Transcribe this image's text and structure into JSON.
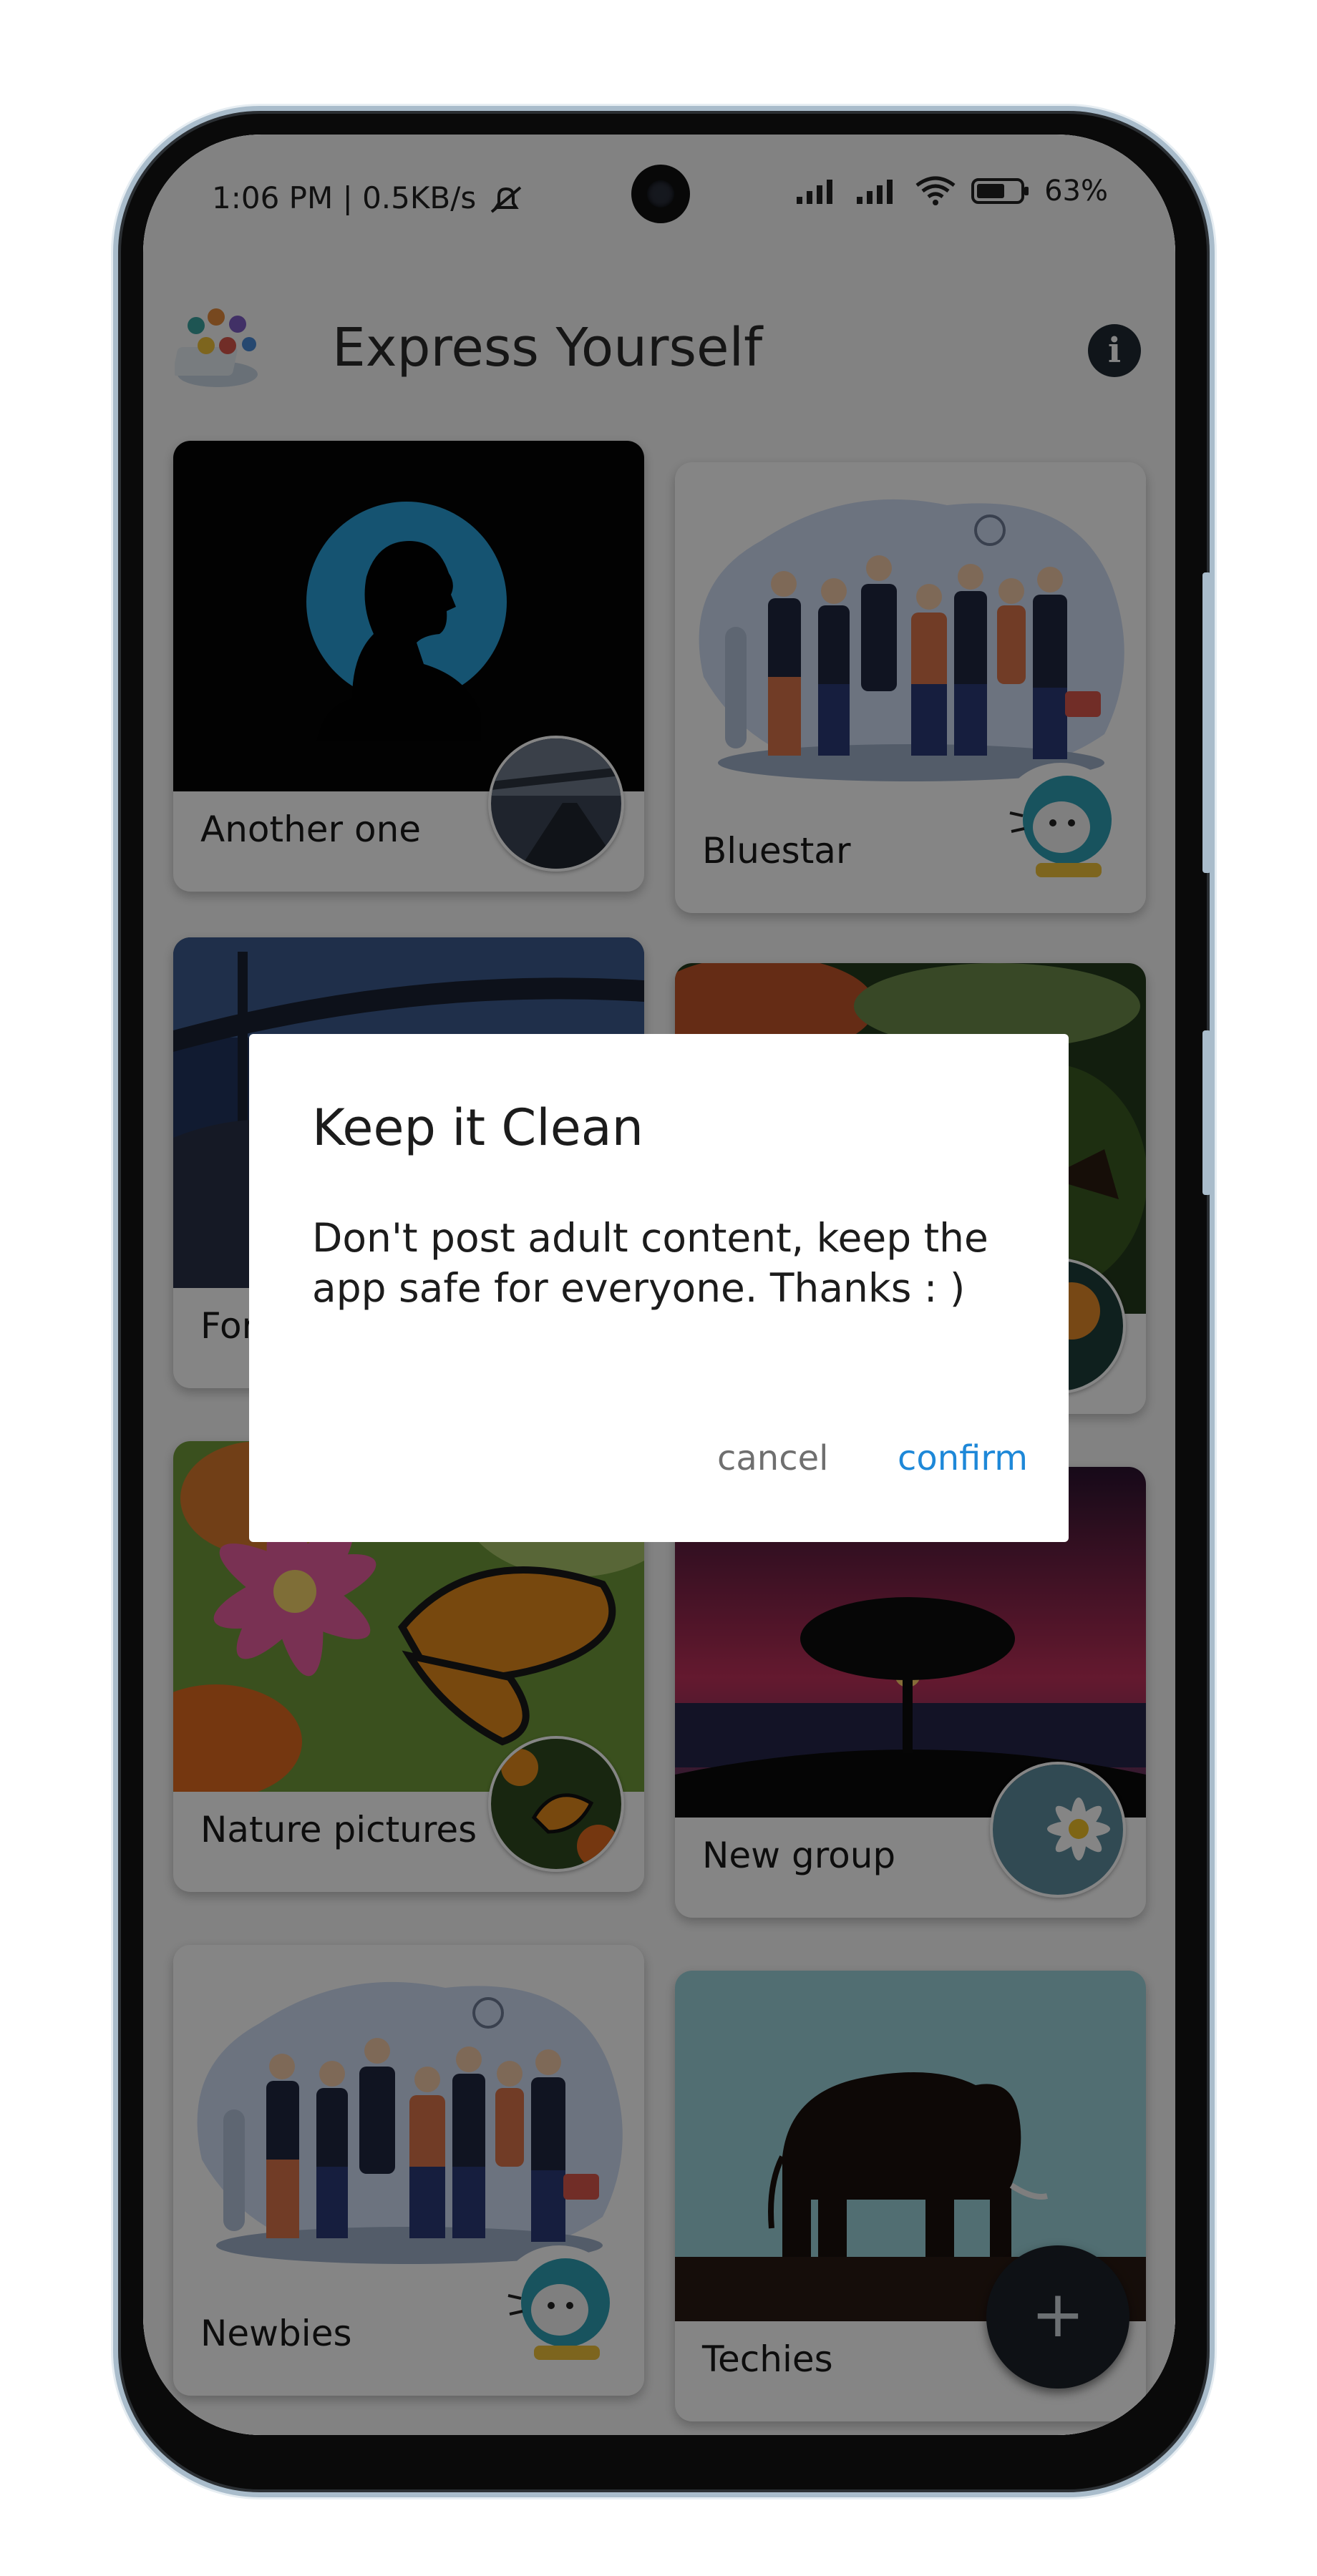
{
  "status_bar": {
    "time_info": "1:06 PM | 0.5KB/s",
    "battery": "63%"
  },
  "app_bar": {
    "title": "Express Yourself",
    "info_icon": "info-icon"
  },
  "groups": [
    {
      "label": "Another one"
    },
    {
      "label": "Bluestar"
    },
    {
      "label": "For"
    },
    {
      "label": ""
    },
    {
      "label": "Nature pictures"
    },
    {
      "label": "New group"
    },
    {
      "label": "Newbies"
    },
    {
      "label": "Techies"
    }
  ],
  "dialog": {
    "title": "Keep it Clean",
    "message": "Don't post adult content, keep the app safe for everyone. Thanks : )",
    "cancel_label": "cancel",
    "confirm_label": "confirm"
  },
  "fab": {
    "symbol": "+"
  },
  "colors": {
    "accent": "#1e88d8",
    "scrim": "#000000",
    "fab": "#1b2229"
  }
}
